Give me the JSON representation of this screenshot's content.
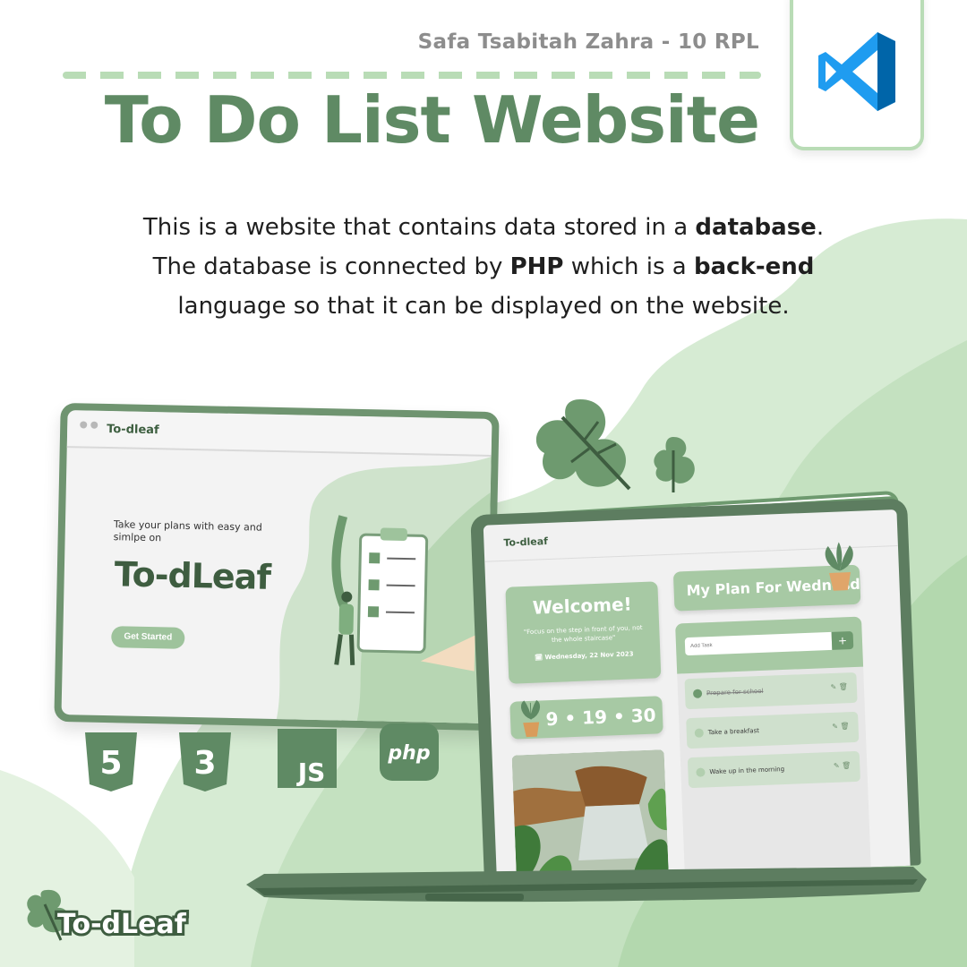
{
  "header": {
    "author": "Safa Tsabitah Zahra - 10 RPL",
    "title": "To Do List Website"
  },
  "description": {
    "part1": "This is a website that contains data stored in a ",
    "bold1": "database",
    "part2": ". The database is connected by ",
    "bold2": "PHP",
    "part3": " which is a ",
    "bold3": "back-end",
    "part4": " language so that it can be displayed on the website."
  },
  "browser_mock": {
    "logo": "To-dleaf",
    "tagline": "Take your plans with easy and simlpe on",
    "brand": "To-dLeaf",
    "cta": "Get Started"
  },
  "tech_icons": {
    "html": "5",
    "css": "3",
    "js": "JS",
    "php": "php"
  },
  "laptop_app": {
    "logo": "To-dleaf",
    "welcome_title": "Welcome!",
    "quote": "\"Focus on the step in front of you, not the whole staircase\"",
    "date": "🗓 Wednesday, 22 Nov 2023",
    "clock": "9 • 19 • 30",
    "plan_title": "My Plan For Wednesday",
    "add_placeholder": "Add Task",
    "add_button": "+",
    "tasks": [
      {
        "label": "Prepare for school",
        "done": true
      },
      {
        "label": "Take a breakfast",
        "done": false
      },
      {
        "label": "Wake up in the morning",
        "done": false
      }
    ],
    "task_actions": "✎ 🗑"
  },
  "footer": {
    "logo": "To-dLeaf"
  },
  "colors": {
    "brand_green": "#5f8a64",
    "light_green": "#b9dcb6",
    "dark_green": "#3e5d40",
    "vscode_blue": "#0a84d6"
  }
}
